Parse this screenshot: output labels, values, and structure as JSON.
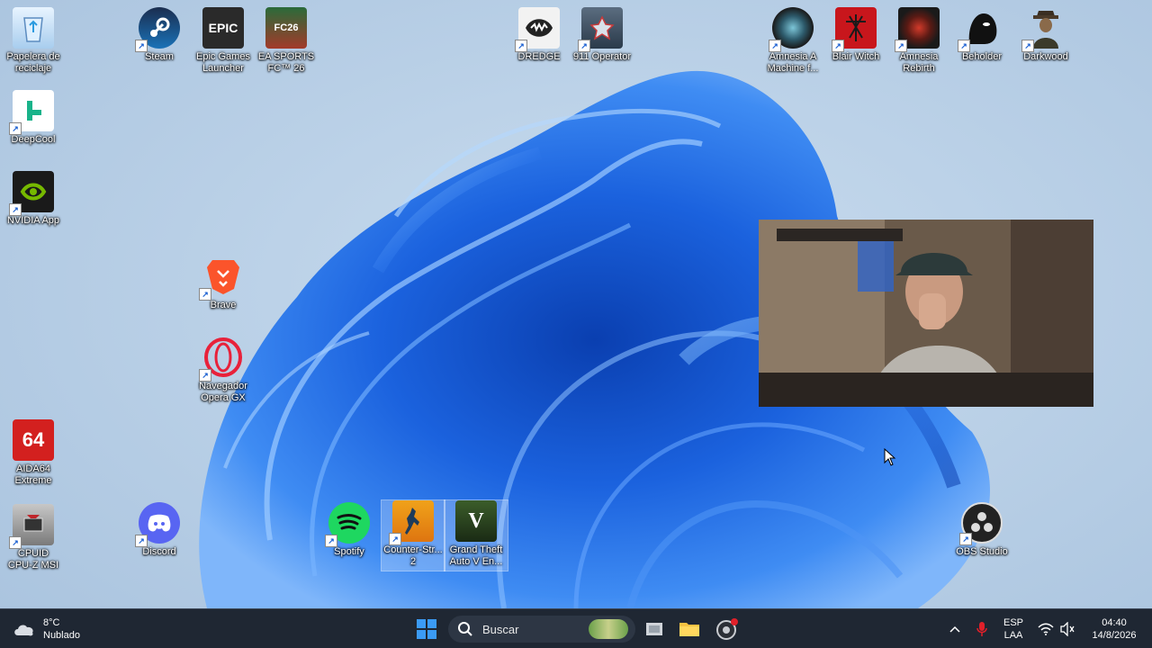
{
  "desktop_icons": {
    "recycle_bin": "Papelera de\nreciclaje",
    "deepcool": "DeepCool",
    "nvidia": "NVIDIA App",
    "aida64": "AIDA64\nExtreme",
    "cpuid": "CPUID\nCPU-Z MSI",
    "steam": "Steam",
    "epic": "Epic Games\nLauncher",
    "easports": "EA SPORTS\nFC™ 26",
    "brave": "Brave",
    "opera": "Navegador\nOpera GX",
    "discord": "Discord",
    "spotify": "Spotify",
    "cs2": "Counter-Str...\n2",
    "gta": "Grand Theft\nAuto V En...",
    "dredge": "DREDGE",
    "operator911": "911 Operator",
    "amnesia_machine": "Amnesia A\nMachine f...",
    "blair_witch": "Blair Witch",
    "amnesia_rebirth": "Amnesia\nRebirth",
    "beholder": "Beholder",
    "darkwood": "Darkwood",
    "obs": "OBS Studio"
  },
  "icon_glyphs": {
    "epic": "EPIC",
    "easports": "FC26",
    "aida64": "64",
    "gta": "V"
  },
  "taskbar": {
    "weather_temp": "8°C",
    "weather_desc": "Nublado",
    "search_placeholder": "Buscar",
    "lang_top": "ESP",
    "lang_bottom": "LAA",
    "time": "04:40",
    "date": "14/8/2026"
  },
  "colors": {
    "taskbar_bg": "#1f2733",
    "windows_blue": "#1a6ae8",
    "wallpaper_blue": "#1e64e0"
  }
}
